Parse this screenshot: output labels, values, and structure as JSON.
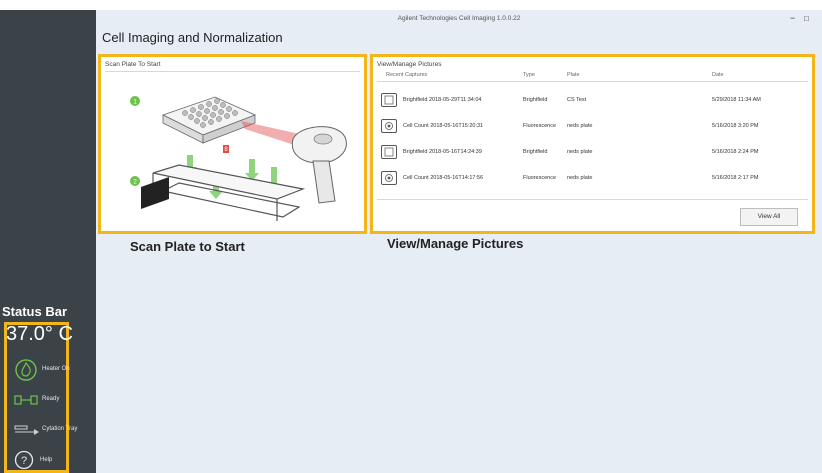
{
  "window": {
    "app_title": "Agilent Technologies Cell Imaging 1.0.0.22",
    "page_title": "Cell Imaging and Normalization",
    "minimize": "−",
    "maximize": "□"
  },
  "scan_panel": {
    "header": "Scan Plate To Start",
    "caption": "Scan Plate to Start",
    "step1": "1",
    "step2": "2",
    "badge": "8"
  },
  "pictures_panel": {
    "header": "View/Manage Pictures",
    "caption": "View/Manage Pictures",
    "columns": [
      "Recent Captures",
      "Type",
      "Plate",
      "Date"
    ],
    "rows": [
      {
        "capture": "Brightfield 2018-05-29T11:34:04",
        "type": "Brightfield",
        "plate": "CS Test",
        "date": "5/29/2018 11:34 AM",
        "icon": "brightfield-icon"
      },
      {
        "capture": "Cell Count 2018-05-16T15:20:31",
        "type": "Fluorescence",
        "plate": "neds plate",
        "date": "5/16/2018 3:20 PM",
        "icon": "fluorescence-icon"
      },
      {
        "capture": "Brightfield 2018-05-16T14:24:39",
        "type": "Brightfield",
        "plate": "neds plate",
        "date": "5/16/2018 2:24 PM",
        "icon": "brightfield-icon"
      },
      {
        "capture": "Cell Count 2018-05-16T14:17:56",
        "type": "Fluorescence",
        "plate": "neds plate",
        "date": "5/16/2018 2:17 PM",
        "icon": "fluorescence-icon"
      }
    ],
    "view_all": "View All"
  },
  "status_bar": {
    "label": "Status Bar",
    "temperature": "37.0° C",
    "items": [
      {
        "label": "Heater On",
        "icon": "heater-icon"
      },
      {
        "label": "Ready",
        "icon": "ready-icon"
      },
      {
        "label": "Cytation Tray",
        "icon": "tray-icon"
      },
      {
        "label": "Help",
        "icon": "help-icon"
      }
    ]
  },
  "colors": {
    "highlight": "#f2b51a",
    "sidebar": "#3c4348",
    "background": "#e6edf4",
    "heater_green": "#6cc24a",
    "laser_red": "#e34b4b"
  }
}
